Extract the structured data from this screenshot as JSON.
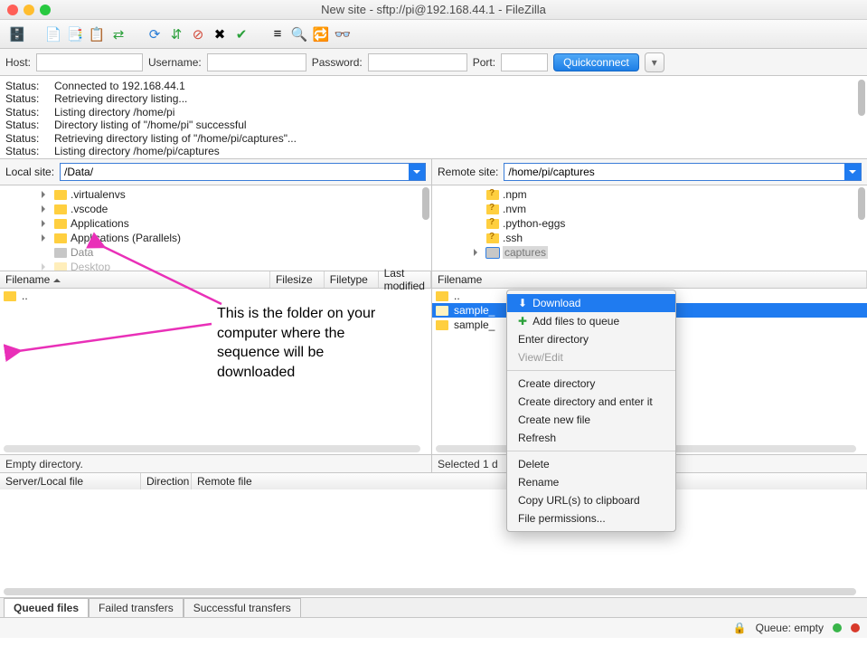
{
  "window": {
    "title": "New site - sftp://pi@192.168.44.1 - FileZilla"
  },
  "quickconnect": {
    "host_label": "Host:",
    "user_label": "Username:",
    "pass_label": "Password:",
    "port_label": "Port:",
    "host": "",
    "user": "",
    "pass": "",
    "port": "",
    "button": "Quickconnect"
  },
  "log": {
    "label": "Status:",
    "lines": [
      "Connected to 192.168.44.1",
      "Retrieving directory listing...",
      "Listing directory /home/pi",
      "Directory listing of \"/home/pi\" successful",
      "Retrieving directory listing of \"/home/pi/captures\"...",
      "Listing directory /home/pi/captures",
      "Directory listing of \"/home/pi/captures\" successful"
    ]
  },
  "local": {
    "label": "Local site:",
    "path": "/Data/",
    "tree": [
      ".virtualenvs",
      ".vscode",
      "Applications",
      "Applications (Parallels)",
      "Data",
      "Desktop"
    ],
    "headers": {
      "name": "Filename",
      "size": "Filesize",
      "type": "Filetype",
      "mod": "Last modified"
    },
    "up": "..",
    "status": "Empty directory."
  },
  "remote": {
    "label": "Remote site:",
    "path": "/home/pi/captures",
    "tree": [
      ".npm",
      ".nvm",
      ".python-eggs",
      ".ssh",
      "captures"
    ],
    "headers": {
      "name": "Filename"
    },
    "up": "..",
    "files": [
      "sample_",
      "sample_"
    ],
    "status": "Selected 1 d"
  },
  "queue_headers": {
    "serverlocal": "Server/Local file",
    "direction": "Direction",
    "remote": "Remote file"
  },
  "tabs": {
    "queued": "Queued files",
    "failed": "Failed transfers",
    "successful": "Successful transfers"
  },
  "bottom": {
    "queue": "Queue: empty"
  },
  "context_menu": {
    "download": "Download",
    "add_queue": "Add files to queue",
    "enter": "Enter directory",
    "viewedit": "View/Edit",
    "create_dir": "Create directory",
    "create_enter": "Create directory and enter it",
    "create_file": "Create new file",
    "refresh": "Refresh",
    "delete": "Delete",
    "rename": "Rename",
    "copy_url": "Copy URL(s) to clipboard",
    "perms": "File permissions..."
  },
  "annotation": "This is the folder on your computer where the sequence will be downloaded",
  "colors": {
    "accent": "#1f7bf0",
    "arrow": "#e930b8"
  }
}
